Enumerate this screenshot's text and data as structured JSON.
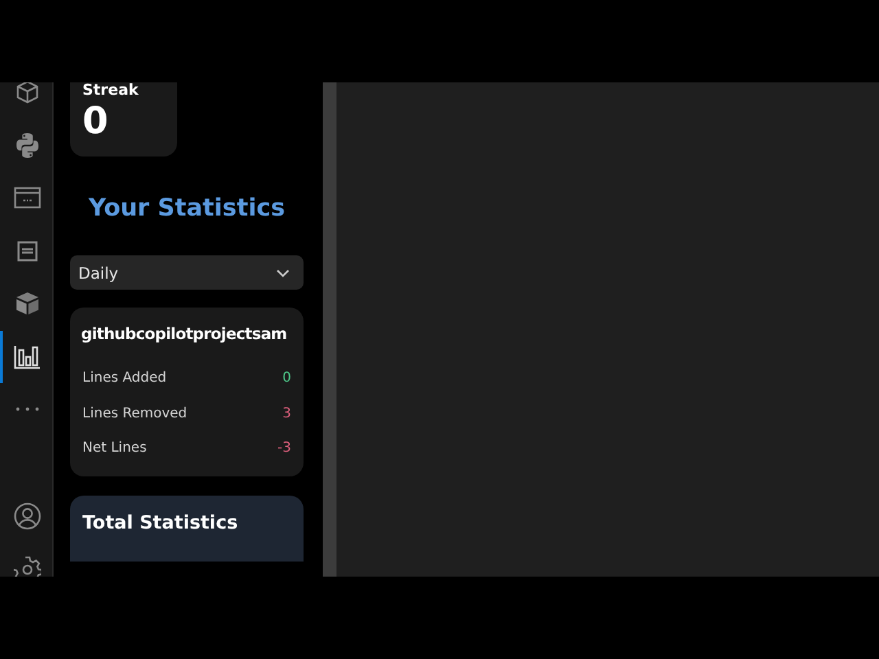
{
  "activity_bar": {
    "top_items": [
      {
        "kind": "cube",
        "selected": false
      },
      {
        "kind": "python",
        "selected": false
      },
      {
        "kind": "window",
        "selected": false
      },
      {
        "kind": "panel",
        "selected": false
      },
      {
        "kind": "package",
        "selected": false
      },
      {
        "kind": "chart",
        "selected": true
      },
      {
        "kind": "more",
        "selected": false
      }
    ],
    "bottom_items": [
      {
        "kind": "account"
      },
      {
        "kind": "settings"
      }
    ]
  },
  "sidebar": {
    "streak_card": {
      "label": "Streak",
      "value": "0"
    },
    "heading": "Your Statistics",
    "period_dropdown": {
      "value": "Daily"
    },
    "project_card": {
      "title": "githubcopilotprojectsam",
      "rows": [
        {
          "label": "Lines Added",
          "value": "0",
          "color": "#4ec98a"
        },
        {
          "label": "Lines Removed",
          "value": "3",
          "color": "#e0607e"
        },
        {
          "label": "Net Lines",
          "value": "-3",
          "color": "#e0607e"
        }
      ]
    },
    "total_card": {
      "title": "Total Statistics"
    }
  }
}
